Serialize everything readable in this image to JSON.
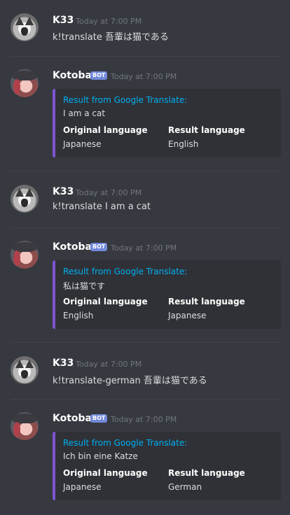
{
  "channel": {
    "messages": [
      {
        "author": "K33",
        "timestamp": "Today at 7:00 PM",
        "text": "k!translate 吾輩は猫である"
      },
      {
        "author": "Kotoba",
        "bot_tag": "BOT",
        "timestamp": "Today at 7:00 PM",
        "embed": {
          "title": "Result from Google Translate:",
          "result": "I am a cat",
          "field1_name": "Original language",
          "field1_value": "Japanese",
          "field2_name": "Result language",
          "field2_value": "English"
        }
      },
      {
        "author": "K33",
        "timestamp": "Today at 7:00 PM",
        "text": "k!translate I am a cat"
      },
      {
        "author": "Kotoba",
        "bot_tag": "BOT",
        "timestamp": "Today at 7:00 PM",
        "embed": {
          "title": "Result from Google Translate:",
          "result": "私は猫です",
          "field1_name": "Original language",
          "field1_value": "English",
          "field2_name": "Result language",
          "field2_value": "Japanese"
        }
      },
      {
        "author": "K33",
        "timestamp": "Today at 7:00 PM",
        "text": "k!translate-german 吾輩は猫である"
      },
      {
        "author": "Kotoba",
        "bot_tag": "BOT",
        "timestamp": "Today at 7:00 PM",
        "embed": {
          "title": "Result from Google Translate:",
          "result": "Ich bin eine Katze",
          "field1_name": "Original language",
          "field1_value": "Japanese",
          "field2_name": "Result language",
          "field2_value": "German"
        }
      }
    ]
  },
  "colors": {
    "background": "#36393f",
    "embed_bg": "#2f3136",
    "embed_accent": "#7d54d2",
    "link_blue": "#00b0f4",
    "bot_tag": "#7289da"
  }
}
